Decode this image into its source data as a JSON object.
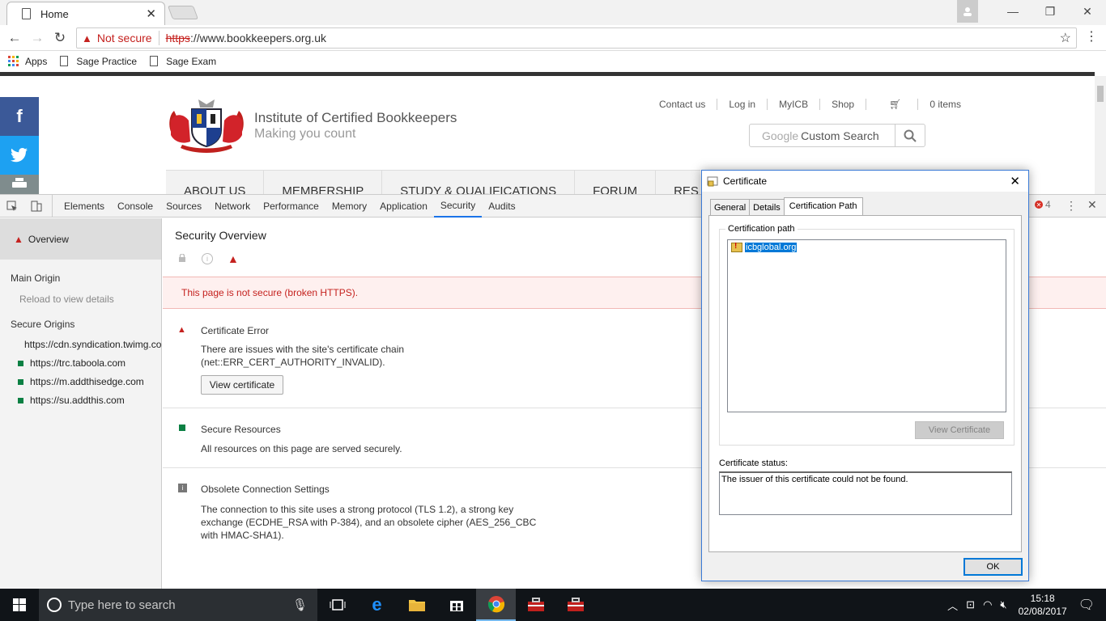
{
  "browser": {
    "tab_title": "Home",
    "tab_close": "✕",
    "url_warning": "Not secure",
    "url_scheme": "https",
    "url_rest": "://www.bookkeepers.org.uk",
    "bookmarks": [
      "Apps",
      "Sage Practice",
      "Sage Exam"
    ]
  },
  "site": {
    "institute": "Institute of Certified Bookkeepers",
    "tagline": "Making you count",
    "top_links": [
      "Contact us",
      "Log in",
      "MyICB",
      "Shop",
      "0 items"
    ],
    "search_brand": "Google",
    "search_label": "Custom Search",
    "nav": [
      "ABOUT US",
      "MEMBERSHIP",
      "STUDY & QUALIFICATIONS",
      "FORUM",
      "RES"
    ]
  },
  "devtools": {
    "tabs": [
      "Elements",
      "Console",
      "Sources",
      "Network",
      "Performance",
      "Memory",
      "Application",
      "Security",
      "Audits"
    ],
    "active_tab": "Security",
    "error_count": "4",
    "sidebar": {
      "overview": "Overview",
      "main_origin": "Main Origin",
      "reload_hint": "Reload to view details",
      "secure_origins_title": "Secure Origins",
      "secure_origins": [
        "https://cdn.syndication.twimg.com",
        "https://trc.taboola.com",
        "https://m.addthisedge.com",
        "https://su.addthis.com"
      ]
    },
    "security": {
      "title": "Security Overview",
      "banner": "This page is not secure (broken HTTPS).",
      "cert_error_title": "Certificate Error",
      "cert_error_line1": "There are issues with the site's certificate chain",
      "cert_error_line2": "(net::ERR_CERT_AUTHORITY_INVALID).",
      "view_cert_button": "View certificate",
      "secure_res_title": "Secure Resources",
      "secure_res_body": "All resources on this page are served securely.",
      "obsolete_title": "Obsolete Connection Settings",
      "obsolete_line1": "The connection to this site uses a strong protocol (TLS 1.2), a strong key",
      "obsolete_line2": "exchange (ECDHE_RSA with P-384), and an obsolete cipher (AES_256_CBC",
      "obsolete_line3": "with HMAC-SHA1)."
    }
  },
  "cert_dialog": {
    "title": "Certificate",
    "tabs": [
      "General",
      "Details",
      "Certification Path"
    ],
    "active_tab": "Certification Path",
    "path_label": "Certification path",
    "path_node": "icbglobal.org",
    "view_cert_button": "View Certificate",
    "status_label": "Certificate status:",
    "status_text": "The issuer of this certificate could not be found.",
    "ok_button": "OK"
  },
  "taskbar": {
    "search_placeholder": "Type here to search",
    "time": "15:18",
    "date": "02/08/2017"
  },
  "colors": {
    "facebook": "#3b5998",
    "twitter": "#1da1f2",
    "print": "#7f8c8d",
    "error_red": "#c5221f",
    "secure_green": "#0b8043",
    "selection_blue": "#0078d7"
  }
}
